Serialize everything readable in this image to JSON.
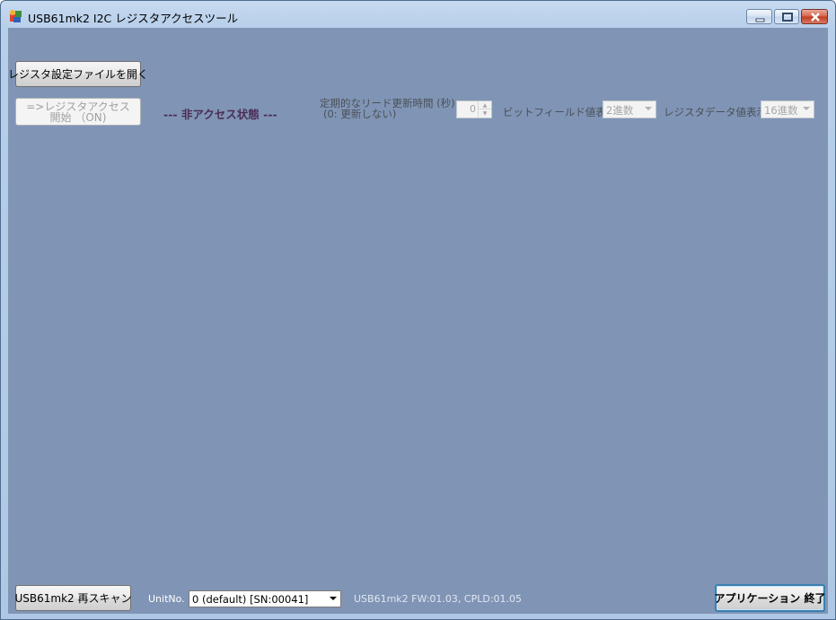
{
  "window": {
    "title": "USB61mk2 I2C レジスタアクセスツール",
    "icon": "app-icon"
  },
  "controls": {
    "open_file_button": "レジスタ設定ファイルを開く",
    "start_access_line1": "=>レジスタアクセス",
    "start_access_line2": "開始 （ON)",
    "status_text": "--- 非アクセス状態 ---",
    "period_label_line1": "定期的なリード更新時間 (秒)",
    "period_label_line2": "(0: 更新しない)",
    "period_value": "0",
    "bitfield_label": "ビットフィールド値表示",
    "bitfield_value": "2進数",
    "regdata_label": "レジスタデータ値表示",
    "regdata_value": "16進数"
  },
  "footer": {
    "rescan_button": "USB61mk2 再スキャン",
    "unit_label": "UnitNo.",
    "unit_value": "0 (default)    [SN:00041]",
    "device_info": "USB61mk2   FW:01.03,   CPLD:01.05",
    "exit_button": "アプリケーション 終了"
  },
  "colors": {
    "client_background": "#8095b5",
    "status_text": "#4b2d55",
    "titlebar": "#c7daf0"
  }
}
